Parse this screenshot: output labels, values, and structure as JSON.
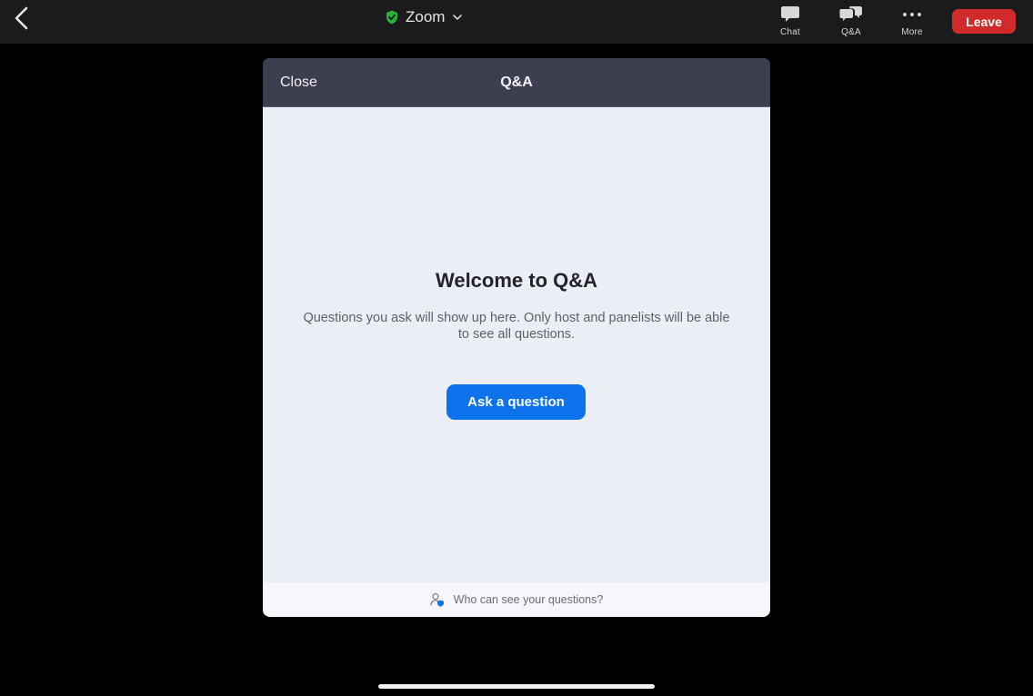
{
  "topbar": {
    "meeting_title": "Zoom",
    "tools": {
      "chat_label": "Chat",
      "qa_label": "Q&A",
      "more_label": "More"
    },
    "leave_label": "Leave",
    "colors": {
      "leave": "#d12a2a",
      "secure_shield": "#27b03c"
    }
  },
  "qa_panel": {
    "close_label": "Close",
    "title": "Q&A",
    "welcome_title": "Welcome to Q&A",
    "welcome_desc": "Questions you ask will show up here. Only host and panelists will be able to see all questions.",
    "ask_button_label": "Ask a question",
    "footer_link": "Who can see your questions?",
    "colors": {
      "primary": "#0e72ed",
      "header": "#3d3e50"
    }
  },
  "icons": {
    "back": "chevron-left-icon",
    "secure": "shield-check-icon",
    "title_dropdown": "chevron-down-icon",
    "chat": "chat-bubble-icon",
    "qa": "qa-bubbles-icon",
    "more": "more-dots-icon",
    "footer": "person-shield-icon"
  }
}
